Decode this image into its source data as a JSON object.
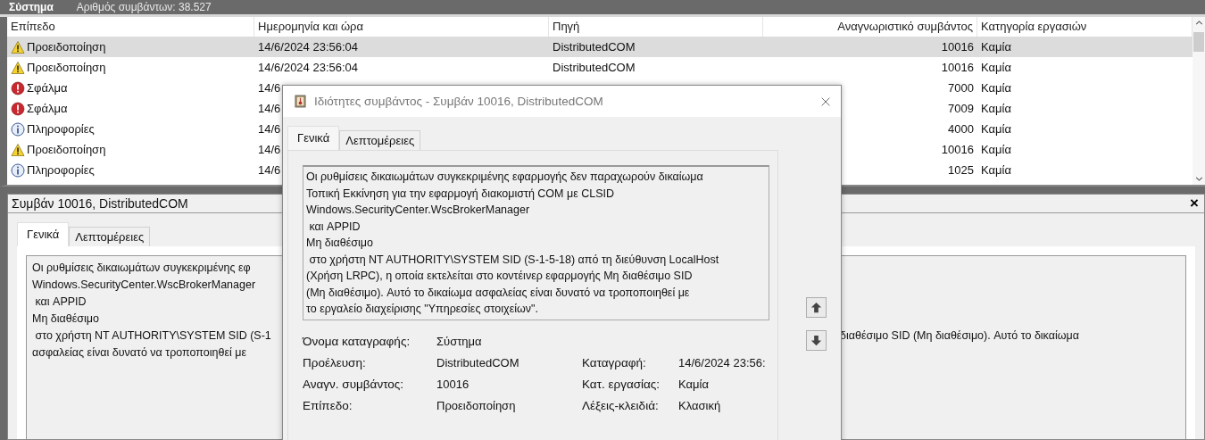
{
  "top_bar": {
    "title": "Σύστημα",
    "count": "Αριθμός συμβάντων: 38.527"
  },
  "table": {
    "columns": [
      "Επίπεδο",
      "Ημερομηνία και ώρα",
      "Πηγή",
      "Αναγνωριστικό συμβάντος",
      "Κατηγορία εργασιών"
    ],
    "rows": [
      {
        "kind": "warning",
        "level": "Προειδοποίηση",
        "date": "14/6/2024 23:56:04",
        "source": "DistributedCOM",
        "event_id": "10016",
        "task_category": "Καμία",
        "selected": true
      },
      {
        "kind": "warning",
        "level": "Προειδοποίηση",
        "date": "14/6/2024 23:56:04",
        "source": "DistributedCOM",
        "event_id": "10016",
        "task_category": "Καμία",
        "selected": false
      },
      {
        "kind": "error",
        "level": "Σφάλμα",
        "date": "14/6",
        "source": "",
        "event_id": "7000",
        "task_category": "Καμία",
        "selected": false
      },
      {
        "kind": "error",
        "level": "Σφάλμα",
        "date": "14/6",
        "source": "",
        "event_id": "7009",
        "task_category": "Καμία",
        "selected": false
      },
      {
        "kind": "info",
        "level": "Πληροφορίες",
        "date": "14/6",
        "source": "",
        "event_id": "4000",
        "task_category": "Καμία",
        "selected": false
      },
      {
        "kind": "warning",
        "level": "Προειδοποίηση",
        "date": "14/6",
        "source": "",
        "event_id": "10016",
        "task_category": "Καμία",
        "selected": false
      },
      {
        "kind": "info",
        "level": "Πληροφορίες",
        "date": "14/6",
        "source": "",
        "event_id": "1025",
        "task_category": "Καμία",
        "selected": false
      }
    ]
  },
  "detail_pane": {
    "title": "Συμβάν 10016, DistributedCOM",
    "close": "×",
    "tabs": [
      {
        "label": "Γενικά",
        "selected": true
      },
      {
        "label": "Λεπτομέρειες",
        "selected": false
      }
    ],
    "text_lines": [
      "Οι ρυθμίσεις δικαιωμάτων συγκεκριμένης εφ",
      "Windows.SecurityCenter.WscBrokerManager",
      " και APPID",
      "Μη διαθέσιμο",
      " στο χρήστη NT AUTHORITY\\SYSTEM SID (S-1",
      "ασφαλείας είναι δυνατό να τροποποιηθεί με"
    ],
    "text_right": "διαθέσιμο SID (Μη διαθέσιμο). Αυτό το δικαίωμα"
  },
  "dialog": {
    "title": "Ιδιότητες συμβάντος - Συμβάν 10016, DistributedCOM",
    "tabs": [
      {
        "label": "Γενικά",
        "selected": true
      },
      {
        "label": "Λεπτομέρειες",
        "selected": false
      }
    ],
    "description": "Οι ρυθμίσεις δικαιωμάτων συγκεκριμένης εφαρμογής δεν παραχωρούν δικαίωμα\nΤοπική Εκκίνηση για την εφαρμογή διακομιστή COM με CLSID\nWindows.SecurityCenter.WscBrokerManager\n και APPID\nΜη διαθέσιμο\n στο χρήστη NT AUTHORITY\\SYSTEM SID (S-1-5-18) από τη διεύθυνση LocalHost\n(Χρήση LRPC), η οποία εκτελείται στο κοντέινερ εφαρμογής Μη διαθέσιμο SID\n(Μη διαθέσιμο). Αυτό το δικαίωμα ασφαλείας είναι δυνατό να τροποποιηθεί με\nτο εργαλείο διαχείρισης \"Υπηρεσίες στοιχείων\".",
    "log_name": {
      "label": "Όνομα καταγραφής:",
      "value": "Σύστημα"
    },
    "fields": [
      {
        "left": {
          "label": "Προέλευση:",
          "value": "DistributedCOM"
        },
        "right": {
          "label": "Καταγραφή:",
          "value": "14/6/2024 23:56:"
        }
      },
      {
        "left": {
          "label": "Αναγν. συμβάντος:",
          "value": "10016"
        },
        "right": {
          "label": "Κατ. εργασίας:",
          "value": "Καμία"
        }
      },
      {
        "left": {
          "label": "Επίπεδο:",
          "value": "Προειδοποίηση"
        },
        "right": {
          "label": "Λέξεις-κλειδιά:",
          "value": "Κλασική"
        }
      }
    ]
  }
}
